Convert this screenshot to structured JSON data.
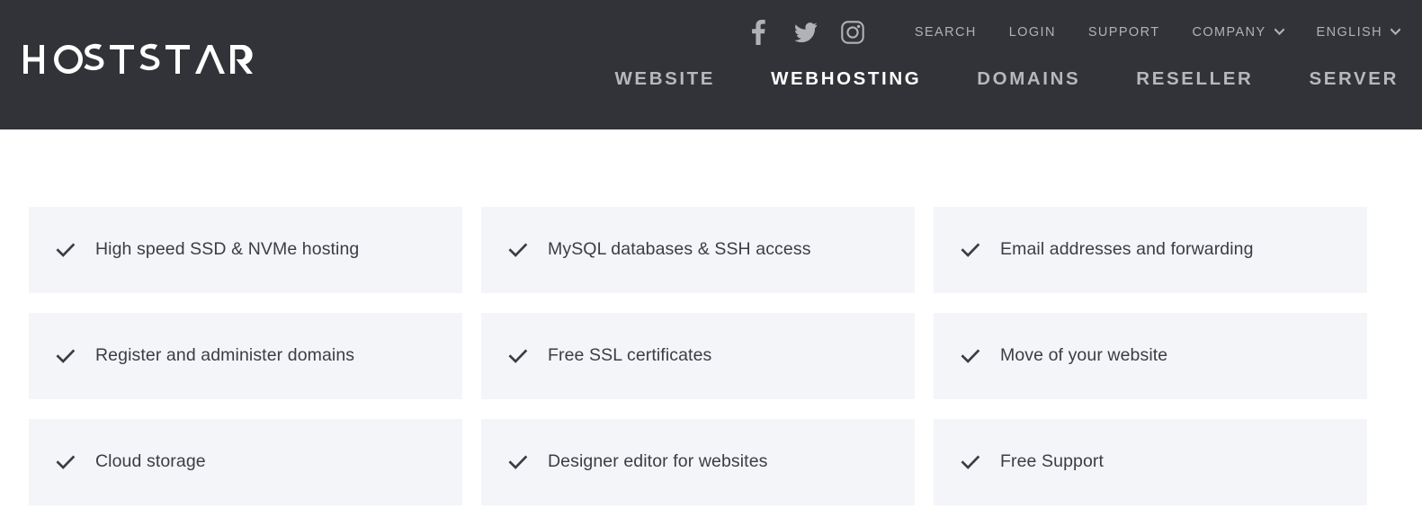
{
  "header": {
    "brand": "HOSTSTAR",
    "social": [
      {
        "name": "facebook-icon",
        "label": "Facebook"
      },
      {
        "name": "twitter-icon",
        "label": "Twitter"
      },
      {
        "name": "instagram-icon",
        "label": "Instagram"
      }
    ],
    "utility_links": [
      {
        "label": "SEARCH",
        "has_chevron": false
      },
      {
        "label": "LOGIN",
        "has_chevron": false
      },
      {
        "label": "SUPPORT",
        "has_chevron": false
      },
      {
        "label": "COMPANY",
        "has_chevron": true
      },
      {
        "label": "ENGLISH",
        "has_chevron": true
      }
    ],
    "nav_items": [
      {
        "label": "WEBSITE",
        "active": false
      },
      {
        "label": "WEBHOSTING",
        "active": true
      },
      {
        "label": "DOMAINS",
        "active": false
      },
      {
        "label": "RESELLER",
        "active": false
      },
      {
        "label": "SERVER",
        "active": false
      }
    ]
  },
  "main": {
    "features": [
      {
        "label": "High speed SSD & NVMe hosting"
      },
      {
        "label": "MySQL databases & SSH access"
      },
      {
        "label": "Email addresses and forwarding"
      },
      {
        "label": "Register and administer domains"
      },
      {
        "label": "Free SSL certificates"
      },
      {
        "label": "Move of your website"
      },
      {
        "label": "Cloud storage"
      },
      {
        "label": "Designer editor for websites"
      },
      {
        "label": "Free Support"
      }
    ]
  },
  "colors": {
    "header_bg": "#313338",
    "nav_inactive": "#b6b8bb",
    "nav_active": "#ffffff",
    "card_bg": "#f4f5f9",
    "card_text": "#3b3d44",
    "page_bg": "#ffffff"
  }
}
